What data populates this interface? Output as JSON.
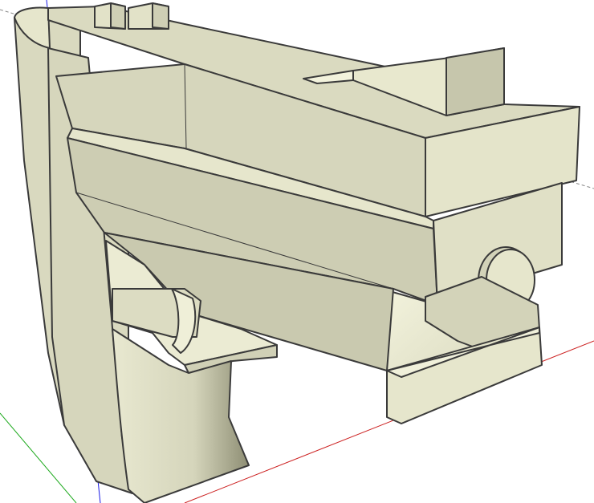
{
  "viewport": {
    "background": "#ffffff",
    "model_face_light": "#e3e3c9",
    "model_face_mid": "#d2d2b8",
    "model_face_dark": "#c4c4aa",
    "model_face_bright": "#f0f0da",
    "edge_color": "#3a3a3a"
  },
  "axes": {
    "red_axis_color": "#cc2020",
    "green_axis_color": "#1faa1f",
    "blue_axis_color": "#1a1ae6"
  },
  "model": {
    "icon": "3d-part-model"
  }
}
